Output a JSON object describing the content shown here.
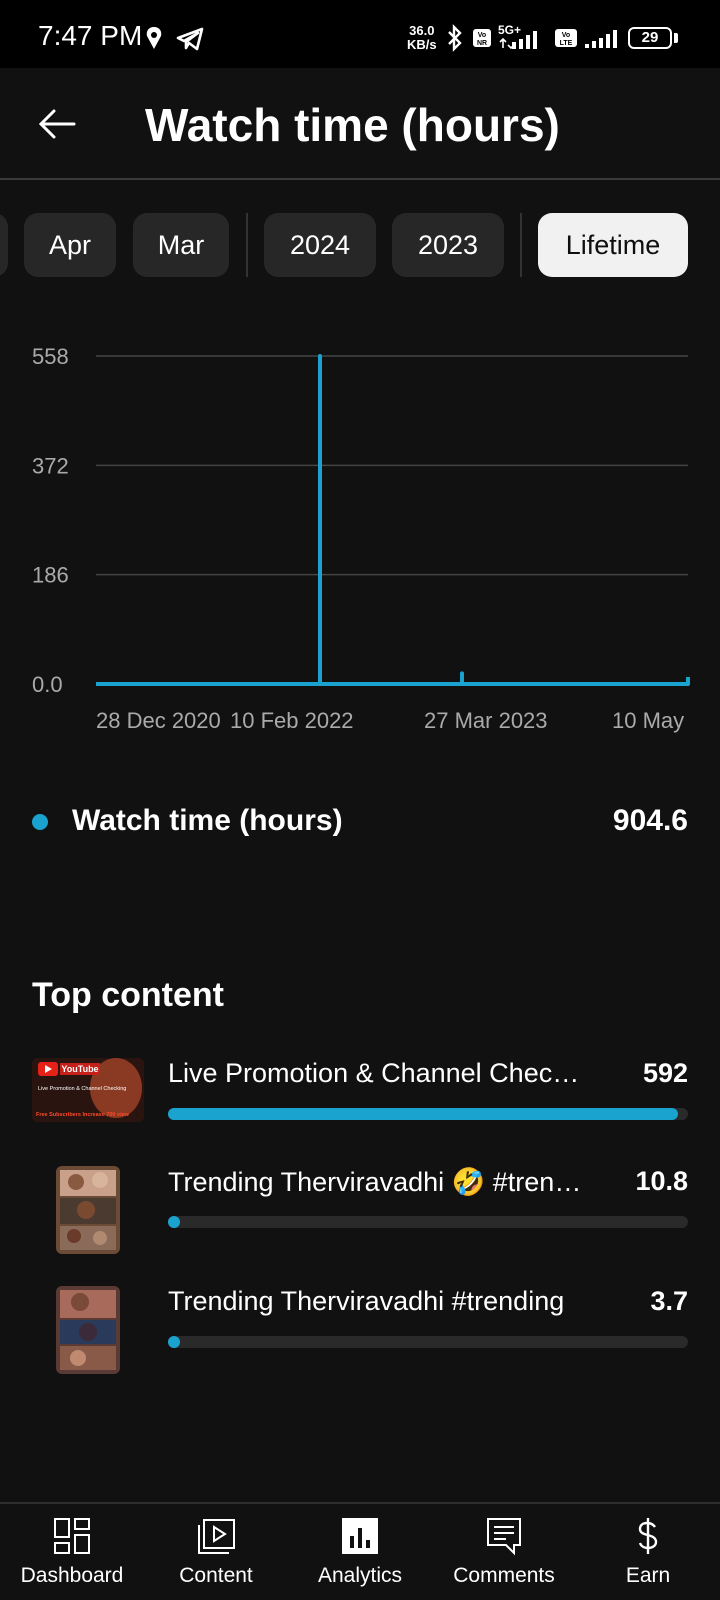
{
  "status_bar": {
    "time": "7:47 PM",
    "speed_value": "36.0",
    "speed_unit": "KB/s",
    "network": "5G+",
    "battery": "29"
  },
  "header": {
    "title": "Watch time (hours)"
  },
  "chips": [
    {
      "label": "Apr",
      "selected": false
    },
    {
      "label": "Mar",
      "selected": false
    },
    {
      "label": "2024",
      "selected": false
    },
    {
      "label": "2023",
      "selected": false
    },
    {
      "label": "Lifetime",
      "selected": true
    }
  ],
  "chart_data": {
    "type": "line",
    "ylim": [
      0,
      558
    ],
    "y_ticks": [
      "558",
      "372",
      "186",
      "0.0"
    ],
    "x_tick_labels": [
      "28 Dec 2020",
      "10 Feb 2022",
      "27 Mar 2023",
      "10 May"
    ],
    "grid": true,
    "series": [
      {
        "name": "Watch time (hours)",
        "color": "#1aa3cf",
        "points": [
          {
            "x": "28 Dec 2020",
            "y": 0
          },
          {
            "x": "10 Feb 2022",
            "y": 0
          },
          {
            "x": "10 Feb 2022",
            "y": 558
          },
          {
            "x": "10 Feb 2022",
            "y": 0
          },
          {
            "x": "27 Mar 2023",
            "y": 0
          },
          {
            "x": "27 Mar 2023",
            "y": 18
          },
          {
            "x": "27 Mar 2023",
            "y": 0
          },
          {
            "x": "10 May",
            "y": 0
          },
          {
            "x": "10 May",
            "y": 12
          }
        ]
      }
    ]
  },
  "summary": {
    "label": "Watch time (hours)",
    "value": "904.6",
    "dot_color": "#1aa3cf"
  },
  "top_content": {
    "title": "Top content",
    "items": [
      {
        "title": "Live Promotion & Channel Checking",
        "value": "592",
        "fraction": 0.98,
        "thumb_text_1": "YouTube",
        "thumb_text_2": "Live Promotion & Channel Checking",
        "thumb_text_3": "Free Subscribers Increase 700 view"
      },
      {
        "title": "Trending Therviravadhi 🤣 #trending",
        "value": "10.8",
        "fraction": 0.018
      },
      {
        "title": "Trending Therviravadhi  #trending",
        "value": "3.7",
        "fraction": 0.006
      }
    ]
  },
  "bottom_nav": {
    "items": [
      {
        "label": "Dashboard",
        "icon": "dashboard-icon",
        "active": false
      },
      {
        "label": "Content",
        "icon": "content-icon",
        "active": false
      },
      {
        "label": "Analytics",
        "icon": "analytics-icon",
        "active": true
      },
      {
        "label": "Comments",
        "icon": "comments-icon",
        "active": false
      },
      {
        "label": "Earn",
        "icon": "earn-icon",
        "active": false
      }
    ]
  }
}
